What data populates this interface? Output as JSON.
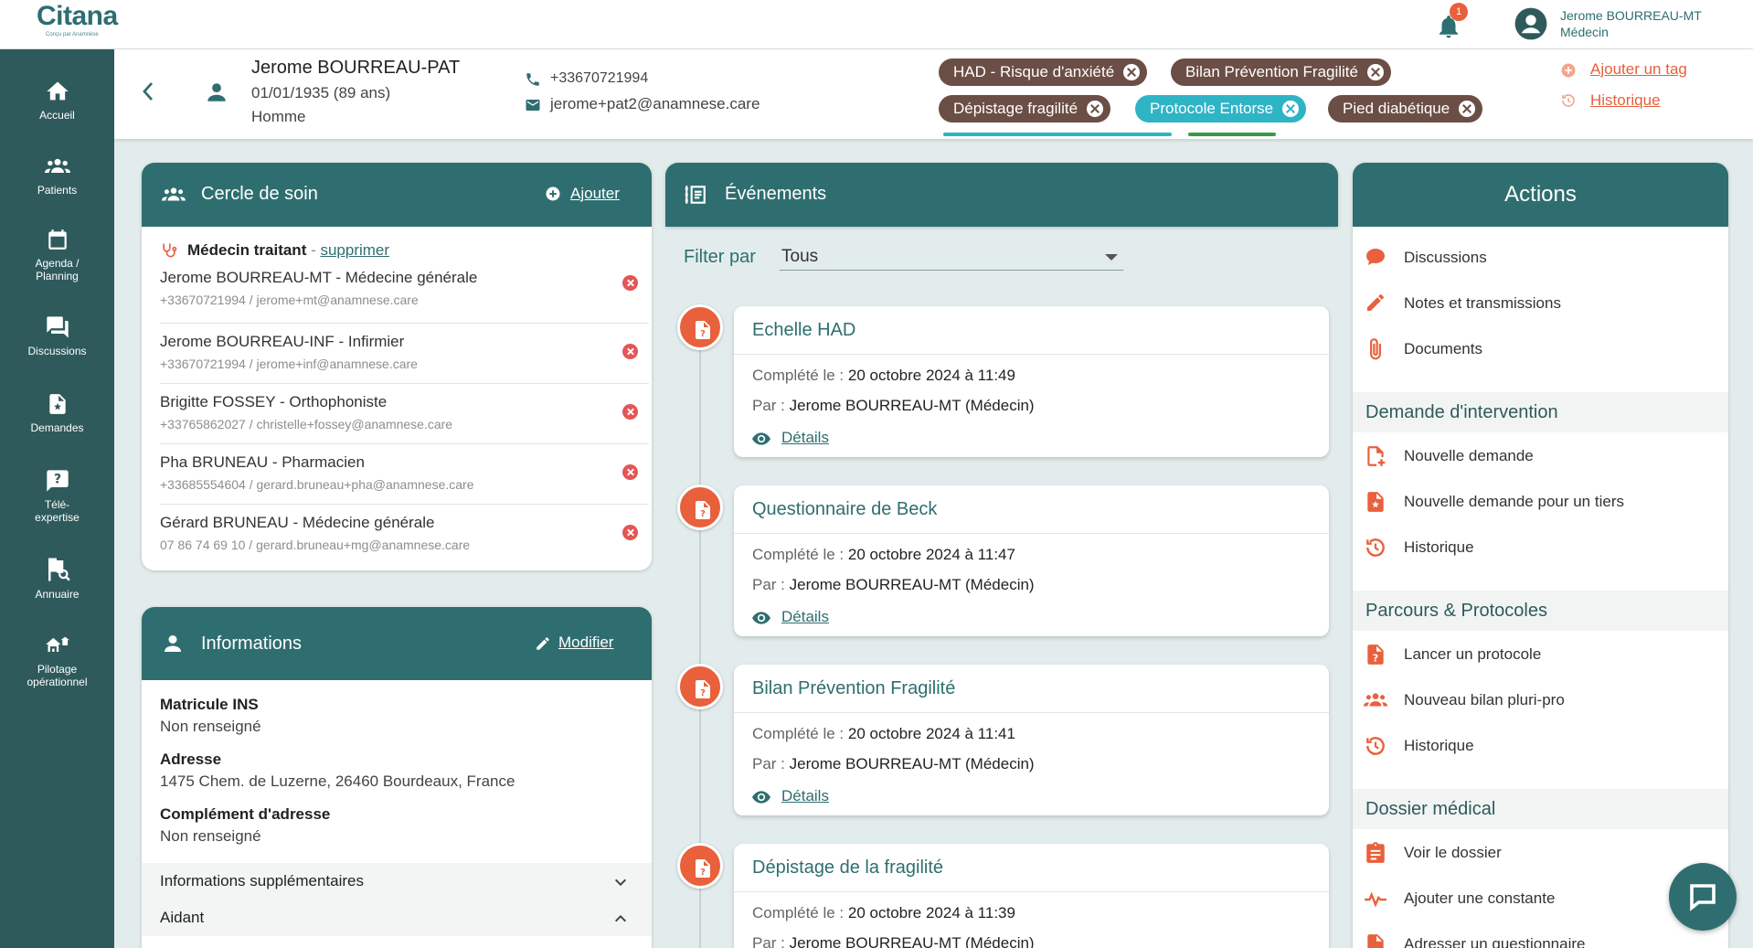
{
  "app": {
    "brand": "Citana",
    "tagline": "Conçu par Anamnèse",
    "notification_count": "1",
    "user_name": "Jerome BOURREAU-MT",
    "user_role": "Médecin"
  },
  "sidebar": {
    "items": [
      {
        "label1": "Accueil",
        "label2": ""
      },
      {
        "label1": "Patients",
        "label2": ""
      },
      {
        "label1": "Agenda /",
        "label2": "Planning"
      },
      {
        "label1": "Discussions",
        "label2": ""
      },
      {
        "label1": "Demandes",
        "label2": ""
      },
      {
        "label1": "Télé-",
        "label2": "expertise"
      },
      {
        "label1": "Annuaire",
        "label2": ""
      },
      {
        "label1": "Pilotage",
        "label2": "opérationnel"
      }
    ]
  },
  "patient": {
    "name": "Jerome BOURREAU-PAT",
    "dob": "01/01/1935 (89 ans)",
    "sex": "Homme",
    "phone": "+33670721994",
    "email": "jerome+pat2@anamnese.care",
    "tags": [
      {
        "label": "HAD - Risque d'anxiété",
        "color": "#6b4e45"
      },
      {
        "label": "Bilan Prévention Fragilité",
        "color": "#6b4e45"
      },
      {
        "label": "Dépistage fragilité",
        "color": "#6b4e45"
      },
      {
        "label": "Protocole Entorse",
        "color": "#2fb4c6"
      },
      {
        "label": "Pied diabétique",
        "color": "#6b4e45"
      }
    ],
    "add_tag_label": "Ajouter un tag",
    "history_label": "Historique"
  },
  "care_circle": {
    "title": "Cercle de soin",
    "add_label": "Ajouter",
    "treating_label": "Médecin traitant",
    "treating_separator": " - ",
    "delete_label": "supprimer",
    "members": [
      {
        "name": "Jerome BOURREAU-MT - Médecine générale",
        "contact": "+33670721994 / jerome+mt@anamnese.care"
      },
      {
        "name": "Jerome BOURREAU-INF - Infirmier",
        "contact": "+33670721994 / jerome+inf@anamnese.care"
      },
      {
        "name": "Brigitte FOSSEY - Orthophoniste",
        "contact": "+33765862027 / christelle+fossey@anamnese.care"
      },
      {
        "name": "Pha BRUNEAU - Pharmacien",
        "contact": "+33685554604 / gerard.bruneau+pha@anamnese.care"
      },
      {
        "name": "Gérard BRUNEAU - Médecine générale",
        "contact": "07 86 74 69 10 / gerard.bruneau+mg@anamnese.care"
      }
    ]
  },
  "informations": {
    "title": "Informations",
    "edit_label": "Modifier",
    "fields": [
      {
        "label": "Matricule INS",
        "value": "Non renseigné"
      },
      {
        "label": "Adresse",
        "value": "1475 Chem. de Luzerne, 26460 Bourdeaux, France"
      },
      {
        "label": "Complément d'adresse",
        "value": "Non renseigné"
      }
    ],
    "accordions": [
      "Informations supplémentaires",
      "Aidant"
    ]
  },
  "events": {
    "title": "Événements",
    "filter_label": "Filter par",
    "filter_value": "Tous",
    "completed_prefix": "Complété le : ",
    "by_prefix": "Par : ",
    "details_label": "Détails",
    "items": [
      {
        "title": "Echelle HAD",
        "date": "20 octobre 2024 à 11:49",
        "by": "Jerome BOURREAU-MT (Médecin)"
      },
      {
        "title": "Questionnaire de Beck",
        "date": "20 octobre 2024 à 11:47",
        "by": "Jerome BOURREAU-MT (Médecin)"
      },
      {
        "title": "Bilan Prévention Fragilité",
        "date": "20 octobre 2024 à 11:41",
        "by": "Jerome BOURREAU-MT (Médecin)"
      },
      {
        "title": "Dépistage de la fragilité",
        "date": "20 octobre 2024 à 11:39",
        "by": "Jerome BOURREAU-MT (Médecin)"
      }
    ]
  },
  "actions": {
    "title": "Actions",
    "general": [
      "Discussions",
      "Notes et transmissions",
      "Documents"
    ],
    "sections": [
      {
        "title": "Demande d'intervention",
        "items": [
          "Nouvelle demande",
          "Nouvelle demande pour un tiers",
          "Historique"
        ]
      },
      {
        "title": "Parcours & Protocoles",
        "items": [
          "Lancer un protocole",
          "Nouveau bilan pluri-pro",
          "Historique"
        ]
      },
      {
        "title": "Dossier médical",
        "items": [
          "Voir le dossier",
          "Ajouter une constante",
          "Adresser un questionnaire"
        ]
      }
    ]
  },
  "colors": {
    "primary": "#2f6e70",
    "sidebar": "#2f5a5c",
    "accent": "#e8603c"
  }
}
